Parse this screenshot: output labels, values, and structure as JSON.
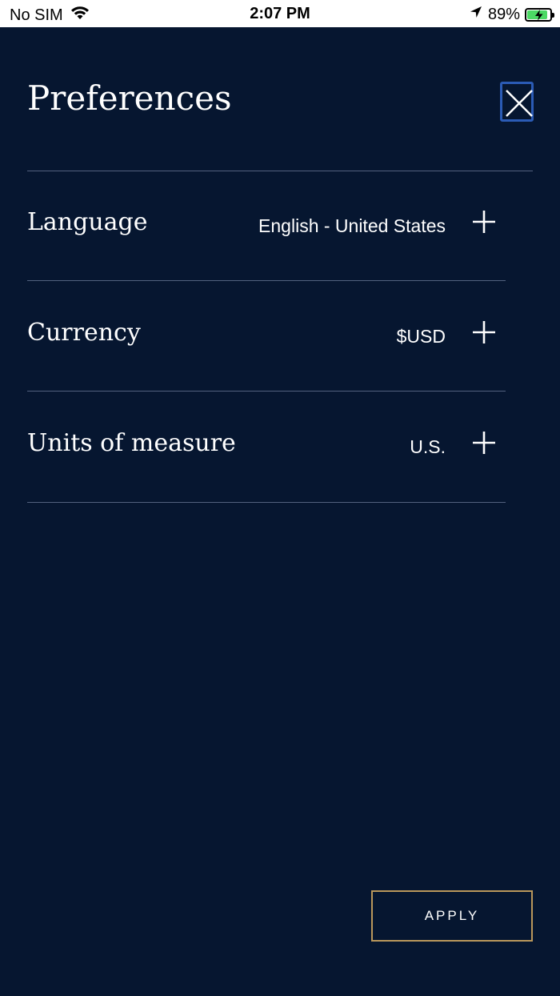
{
  "status_bar": {
    "carrier": "No SIM",
    "time": "2:07 PM",
    "battery_percent": "89%",
    "battery_level": 0.89,
    "battery_color": "#4cd964",
    "icons": [
      "wifi-icon",
      "location-arrow-icon",
      "battery-charging-icon"
    ]
  },
  "header": {
    "title": "Preferences",
    "close_icon": "close-icon",
    "close_border_color": "#2b5bb5"
  },
  "preferences": [
    {
      "label": "Language",
      "value": "English - United States",
      "icon": "plus-icon"
    },
    {
      "label": "Currency",
      "value": "$USD",
      "icon": "plus-icon"
    },
    {
      "label": "Units of measure",
      "value": "U.S.",
      "icon": "plus-icon"
    }
  ],
  "footer": {
    "apply_label": "APPLY",
    "apply_border_color": "#b9975b"
  },
  "colors": {
    "background": "#061630",
    "divider": "#52617e",
    "text": "#ffffff"
  }
}
